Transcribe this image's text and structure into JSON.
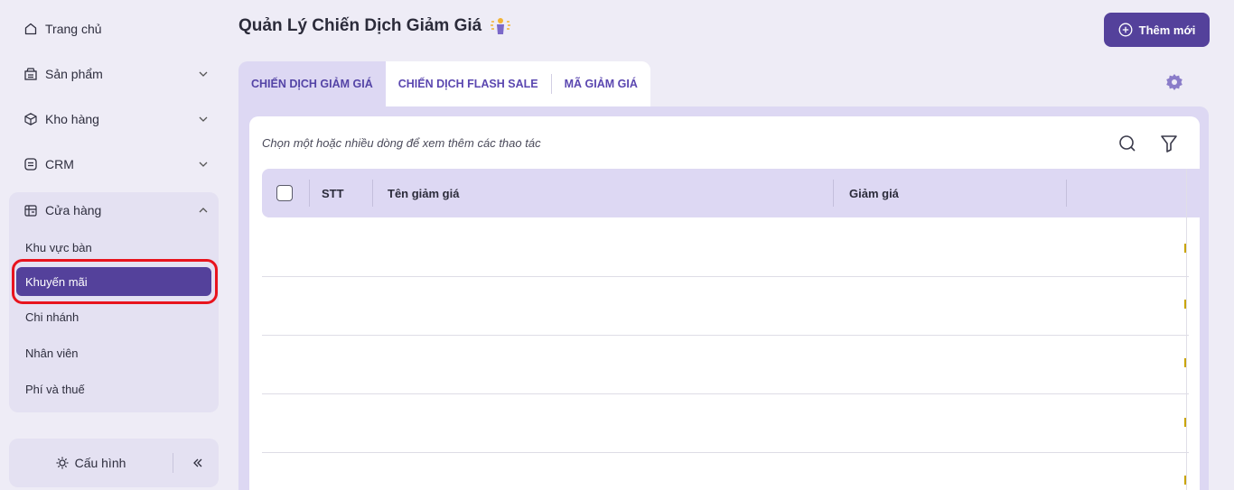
{
  "sidebar": {
    "items": [
      {
        "label": "Trang chủ",
        "icon": "home-icon"
      },
      {
        "label": "Sản phẩm",
        "icon": "product-icon"
      },
      {
        "label": "Kho hàng",
        "icon": "warehouse-icon"
      },
      {
        "label": "CRM",
        "icon": "crm-icon"
      },
      {
        "label": "Cửa hàng",
        "icon": "store-icon"
      }
    ],
    "store_sub_items": [
      {
        "label": "Khu vực bàn"
      },
      {
        "label": "Khuyến mãi"
      },
      {
        "label": "Chi nhánh"
      },
      {
        "label": "Nhân viên"
      },
      {
        "label": "Phí và thuế"
      }
    ],
    "config_label": "Cấu hình"
  },
  "header": {
    "title": "Quản Lý Chiến Dịch Giảm Giá",
    "add_label": "Thêm mới"
  },
  "tabs": [
    {
      "label": "CHIẾN DỊCH GIẢM GIÁ"
    },
    {
      "label": "CHIẾN DỊCH FLASH SALE"
    },
    {
      "label": "MÃ GIẢM GIÁ"
    }
  ],
  "table": {
    "hint": "Chọn một hoặc nhiều dòng để xem thêm các thao tác",
    "columns": [
      "STT",
      "Tên giảm giá",
      "Giảm giá"
    ]
  },
  "colors": {
    "accent": "#54419b",
    "tab_active_bg": "#ddd8f3",
    "highlight": "#e8141e"
  }
}
